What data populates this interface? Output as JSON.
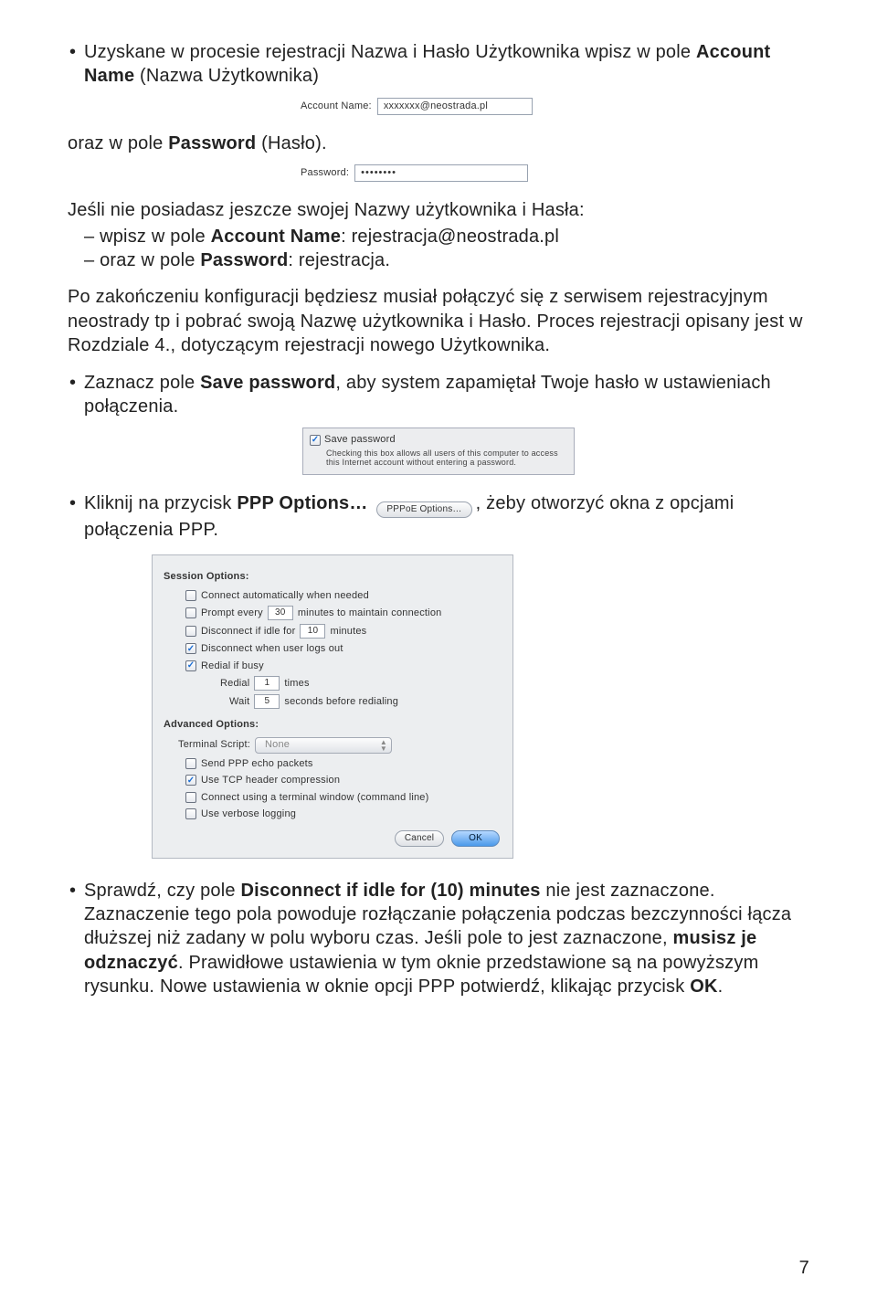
{
  "bullets": {
    "b1": "Uzyskane w procesie rejestracji Nazwa i Hasło Użytkownika wpisz w pole ",
    "b1_bold": "Account Name",
    "b1_tail": " (Nazwa Użytkownika)"
  },
  "account_field": {
    "label": "Account Name:",
    "value": "xxxxxxx@neostrada.pl"
  },
  "p_oraz": "oraz w pole ",
  "p_oraz_bold": "Password",
  "p_oraz_tail": " (Hasło).",
  "password_field": {
    "label": "Password:",
    "value": "••••••••"
  },
  "p_jesli": "Jeśli nie posiadasz jeszcze swojej Nazwy użytkownika i Hasła:",
  "dash1_pre": "– wpisz w pole ",
  "dash1_bold": "Account Name",
  "dash1_tail": ": rejestracja@neostrada.pl",
  "dash2_pre": "– oraz w pole ",
  "dash2_bold": "Password",
  "dash2_tail": ": rejestracja.",
  "p_po_zak": "Po zakończeniu konfiguracji będziesz musiał połączyć się z serwisem rejestracyjnym neostrady tp i pobrać swoją Nazwę użytkownika i Hasło. Proces rejestracji opisany jest w Rozdziale 4., dotyczącym rejestracji nowego Użytkownika.",
  "b_save_pre": "Zaznacz pole ",
  "b_save_bold": "Save password",
  "b_save_tail": ", aby system zapamiętał Twoje hasło w ustawieniach połączenia.",
  "savebox": {
    "label": "Save password",
    "desc": "Checking this box allows all users of this computer to access this Internet account without entering a password."
  },
  "b_ppp_pre": "Kliknij na przycisk ",
  "b_ppp_bold": "PPP Options…",
  "b_ppp_btn": "PPPoE Options…",
  "b_ppp_tail": ", żeby otworzyć okna z opcjami połączenia PPP.",
  "panel": {
    "session_hdr": "Session Options:",
    "opt_connect_auto": "Connect automatically when needed",
    "opt_prompt_pre": "Prompt every",
    "opt_prompt_val": "30",
    "opt_prompt_post": "minutes to maintain connection",
    "opt_disconnect_idle_pre": "Disconnect if idle for",
    "opt_disconnect_idle_val": "10",
    "opt_disconnect_idle_post": "minutes",
    "opt_disconnect_logout": "Disconnect when user logs out",
    "opt_redial_busy": "Redial if busy",
    "opt_redial_label": "Redial",
    "opt_redial_val": "1",
    "opt_redial_post": "times",
    "opt_wait_label": "Wait",
    "opt_wait_val": "5",
    "opt_wait_post": "seconds before redialing",
    "adv_hdr": "Advanced Options:",
    "term_script_label": "Terminal Script:",
    "term_script_val": "None",
    "opt_send_echo": "Send PPP echo packets",
    "opt_tcp_header": "Use TCP header compression",
    "opt_connect_terminal": "Connect using a terminal window (command line)",
    "opt_verbose": "Use verbose logging",
    "btn_cancel": "Cancel",
    "btn_ok": "OK"
  },
  "b_last_pre": "Sprawdź, czy pole ",
  "b_last_bold1": "Disconnect if idle for (10) minutes",
  "b_last_m1": " nie jest zaznaczone. Zaznaczenie tego pola powoduje rozłączanie połączenia podczas bezczynności łącza dłuższej niż zadany w polu wyboru czas. Jeśli pole to jest zaznaczone, ",
  "b_last_bold2": "musisz je odznaczyć",
  "b_last_m2": ". Prawidłowe ustawienia w tym oknie przedstawione są na powyższym rysunku. Nowe ustawienia w oknie opcji PPP potwierdź, klikając przycisk ",
  "b_last_bold3": "OK",
  "b_last_tail": ".",
  "page_number": "7"
}
